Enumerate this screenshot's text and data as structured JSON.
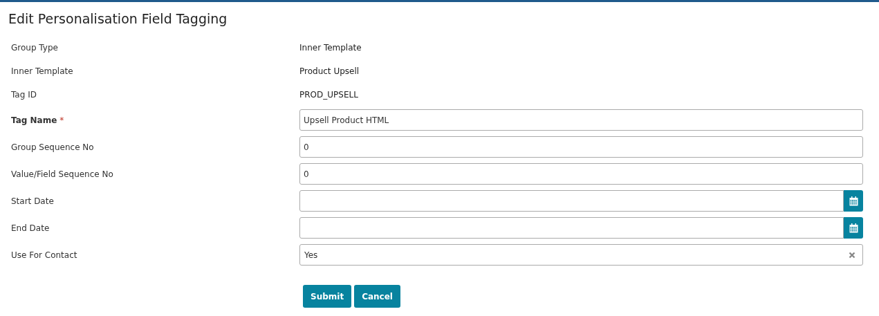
{
  "title": "Edit Personalisation Field Tagging",
  "rows": [
    {
      "kind": "static",
      "label": "Group Type",
      "value": "Inner Template"
    },
    {
      "kind": "static",
      "label": "Inner Template",
      "value": "Product Upsell"
    },
    {
      "kind": "static",
      "label": "Tag ID",
      "value": "PROD_UPSELL"
    },
    {
      "kind": "text",
      "label": "Tag Name",
      "required_mark": "*",
      "value": "Upsell Product HTML"
    },
    {
      "kind": "text",
      "label": "Group Sequence No",
      "value": "0"
    },
    {
      "kind": "text",
      "label": "Value/Field Sequence No",
      "value": "0"
    },
    {
      "kind": "date",
      "label": "Start Date"
    },
    {
      "kind": "date",
      "label": "End Date"
    },
    {
      "kind": "select",
      "label": "Use For Contact",
      "value": "Yes"
    }
  ],
  "buttons": [
    "Submit",
    "Cancel"
  ]
}
